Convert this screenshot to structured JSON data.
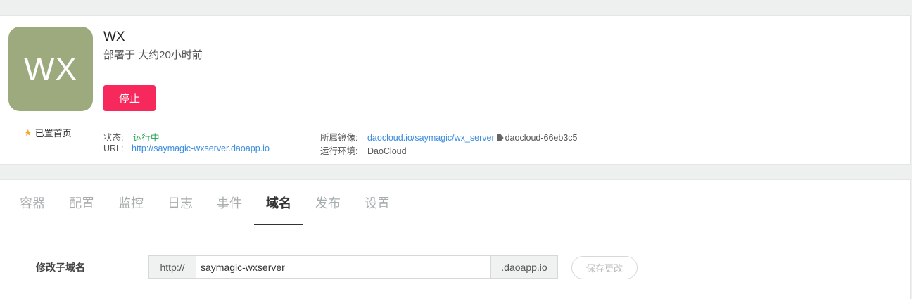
{
  "app": {
    "avatar_text": "WX",
    "name": "WX",
    "deployed": "部署于 大约20小时前",
    "stop_label": "停止",
    "pinned_label": "已置首页"
  },
  "meta": {
    "status_label": "状态:",
    "status_value": "运行中",
    "url_label": "URL:",
    "url_value": "http://saymagic-wxserver.daoapp.io",
    "image_label": "所属镜像:",
    "image_value": "daocloud.io/saymagic/wx_server",
    "image_tag": "daocloud-66eb3c5",
    "env_label": "运行环境:",
    "env_value": "DaoCloud"
  },
  "tabs": [
    {
      "label": "容器"
    },
    {
      "label": "配置"
    },
    {
      "label": "监控"
    },
    {
      "label": "日志"
    },
    {
      "label": "事件"
    },
    {
      "label": "域名",
      "active": true
    },
    {
      "label": "发布"
    },
    {
      "label": "设置"
    }
  ],
  "domain_form": {
    "label": "修改子域名",
    "prefix": "http://",
    "value": "saymagic-wxserver",
    "suffix": ".daoapp.io",
    "save_label": "保存更改"
  },
  "colors": {
    "accent": "#f7285b",
    "avatar": "#9caa7e",
    "link": "#3a8de0",
    "status_green": "#22a050"
  }
}
